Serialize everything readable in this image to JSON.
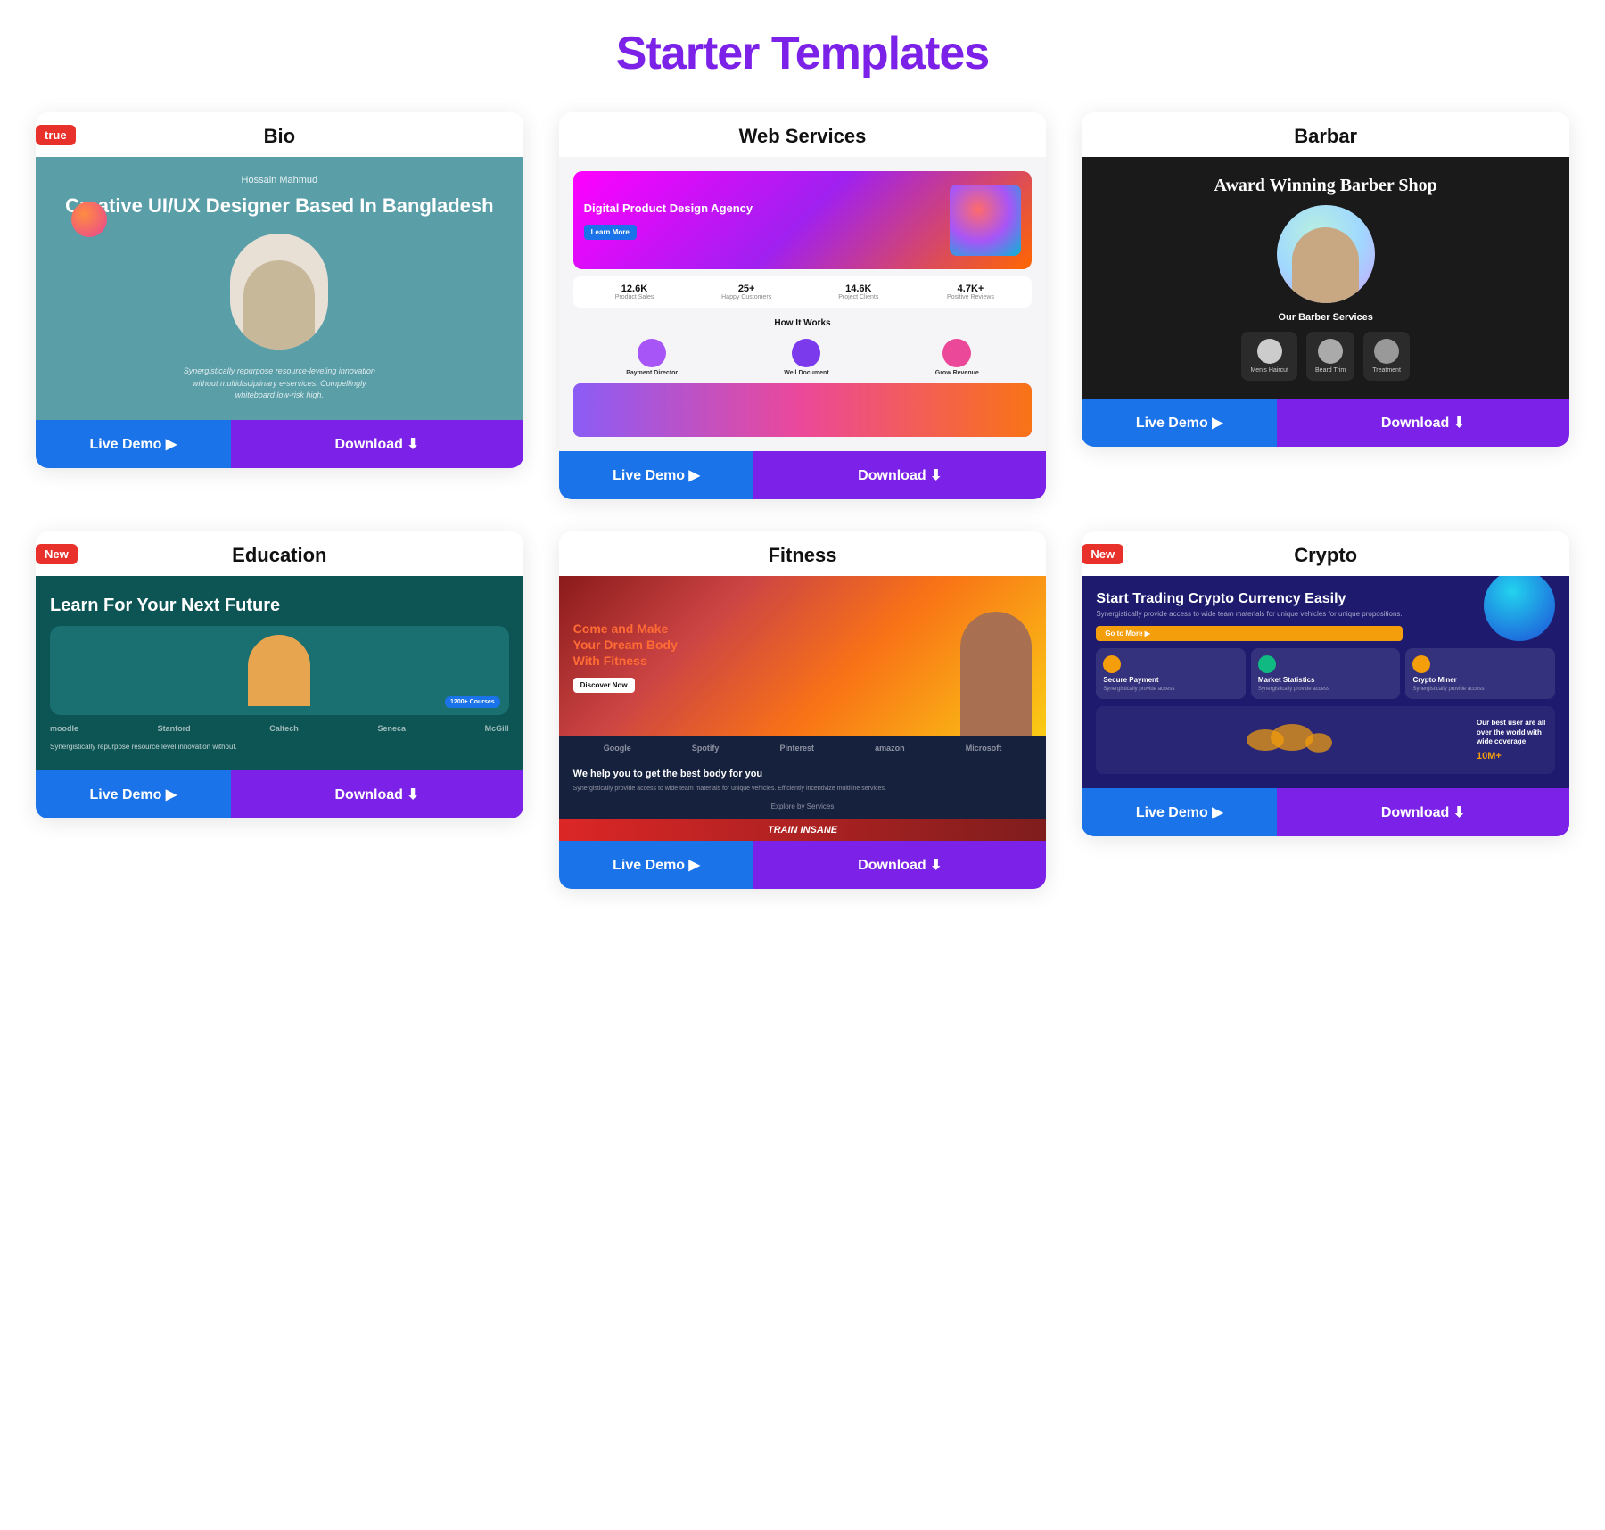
{
  "page": {
    "title": "Starter Templates"
  },
  "cards": [
    {
      "id": "bio",
      "title": "Bio",
      "is_new": true,
      "live_label": "Live Demo ▶",
      "download_label": "Download ⬇"
    },
    {
      "id": "web-services",
      "title": "Web Services",
      "is_new": false,
      "live_label": "Live Demo ▶",
      "download_label": "Download ⬇"
    },
    {
      "id": "barbar",
      "title": "Barbar",
      "is_new": false,
      "live_label": "Live Demo ▶",
      "download_label": "Download ⬇"
    },
    {
      "id": "education",
      "title": "Education",
      "is_new": true,
      "live_label": "Live Demo ▶",
      "download_label": "Download ⬇"
    },
    {
      "id": "fitness",
      "title": "Fitness",
      "is_new": false,
      "live_label": "Live Demo ▶",
      "download_label": "Download ⬇"
    },
    {
      "id": "crypto",
      "title": "Crypto",
      "is_new": true,
      "live_label": "Live Demo ▶",
      "download_label": "Download ⬇"
    }
  ],
  "bio": {
    "designer_name": "Hossain Mahmud",
    "headline": "Creative UI/UX Designer Based In Bangladesh",
    "description": "Synergistically repurpose resource-leveling innovation without multidisciplinary e-services. Compellingly whiteboard low-risk high."
  },
  "web_services": {
    "hero_title": "Digital Product Design Agency",
    "stats": [
      {
        "num": "12.6K",
        "label": "Product Sales"
      },
      {
        "num": "25+",
        "label": "Happy Customers"
      },
      {
        "num": "14.6K",
        "label": "Project Clients"
      },
      {
        "num": "4.7K+",
        "label": "Positive Reviews"
      }
    ],
    "how_it_works": "How It Works",
    "icons": [
      {
        "label": "Payment Director"
      },
      {
        "label": "Well Document"
      },
      {
        "label": "Grow Revenue"
      }
    ]
  },
  "barbar": {
    "title": "Award Winning Barber Shop",
    "services_label": "Our Barber Services",
    "services": [
      {
        "name": "Men's Haircut"
      },
      {
        "name": "Beard Trim"
      },
      {
        "name": "Treatment"
      }
    ]
  },
  "education": {
    "title": "Learn For Your Next Future",
    "logos": [
      "moodle",
      "Stanford",
      "Caltech",
      "Seneca",
      "McGill"
    ],
    "counter": "1200+ Courses",
    "desc": "Synergistically repurpose resource level innovation without."
  },
  "fitness": {
    "hero_title": "Come and Make Your Dream Body",
    "hero_subtitle": "With Fitness",
    "body_title": "We help you to get the best body for you",
    "logos": [
      "Google",
      "Spotify",
      "Pinterest",
      "amazon",
      "Microsoft"
    ],
    "explore": "Explore by Services",
    "stamp": "TRAIN INSANE"
  },
  "crypto": {
    "title": "Start Trading Crypto Currency Easily",
    "desc": "Synergistically provide access to wide team materials for unique vehicles for unique propositions.",
    "btn": "Go to More ▶",
    "cards": [
      {
        "title": "Secure Payment",
        "text": "Synergistically provide access"
      },
      {
        "title": "Market Statistics",
        "text": "Synergistically provide access"
      },
      {
        "title": "Crypto Miner",
        "text": "Synergistically provide access"
      }
    ],
    "world_title": "Our best user are all over the world with wide coverage",
    "users": "10M+"
  }
}
